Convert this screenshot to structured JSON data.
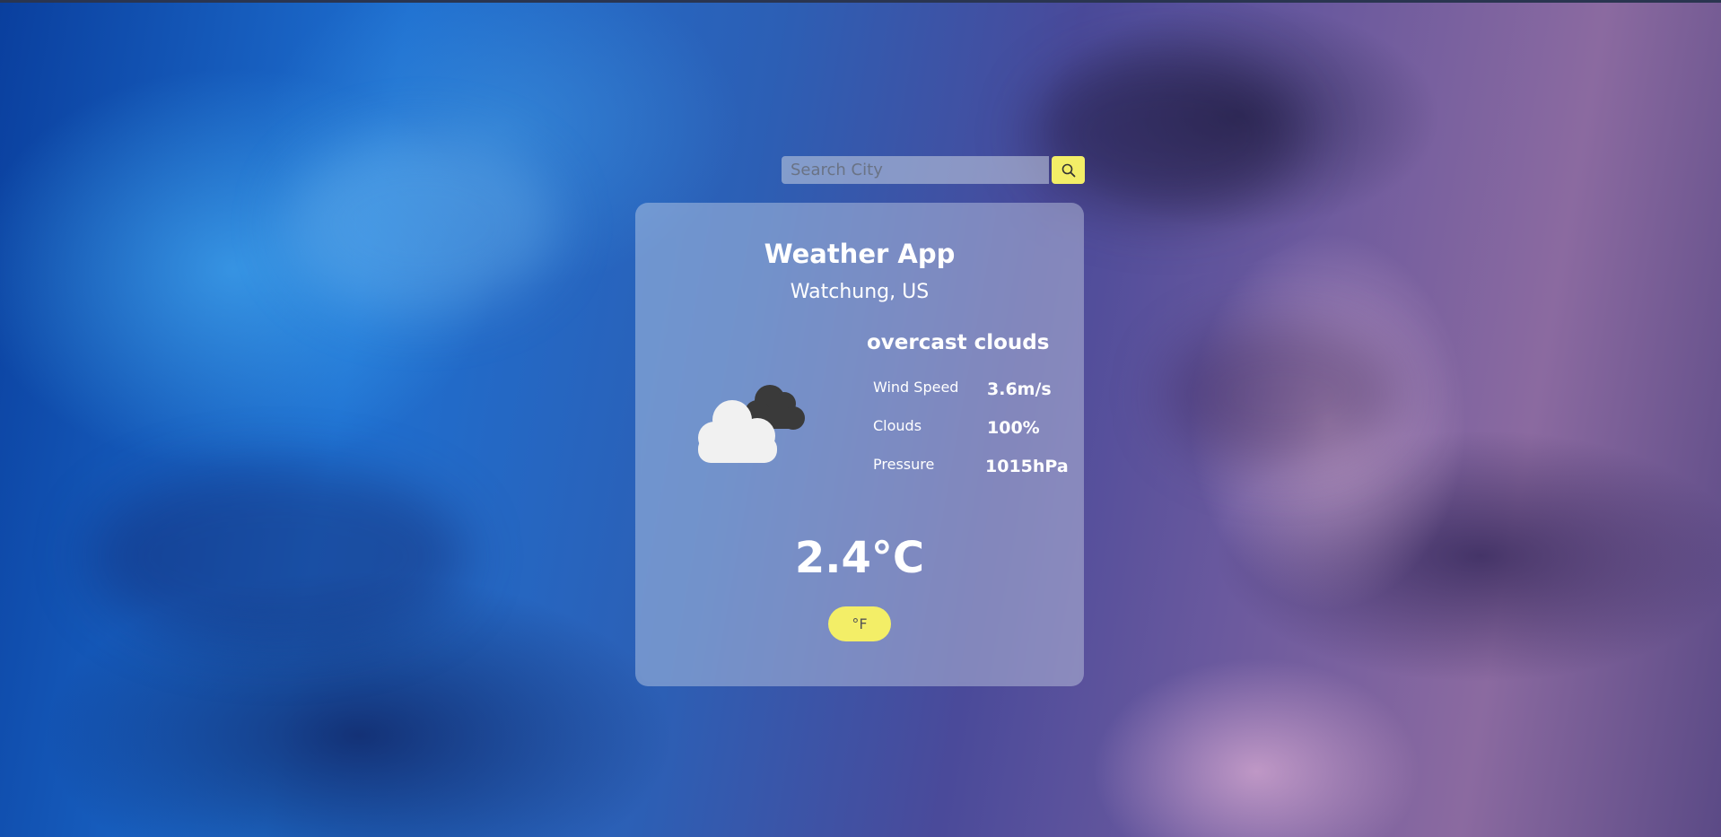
{
  "search": {
    "placeholder": "Search City",
    "value": "",
    "button_icon": "search-icon"
  },
  "card": {
    "title": "Weather App",
    "location": "Watchung, US",
    "description": "overcast clouds",
    "weather_icon": "cloud-icon",
    "stats": [
      {
        "label": "Wind Speed",
        "value": "3.6m/s"
      },
      {
        "label": "Clouds",
        "value": "100%"
      },
      {
        "label": "Pressure",
        "value": "1015hPa"
      }
    ],
    "temperature": "2.4°C",
    "unit_toggle_label": "°F"
  },
  "colors": {
    "accent": "#f3ee67",
    "card_text": "#ffffff"
  }
}
